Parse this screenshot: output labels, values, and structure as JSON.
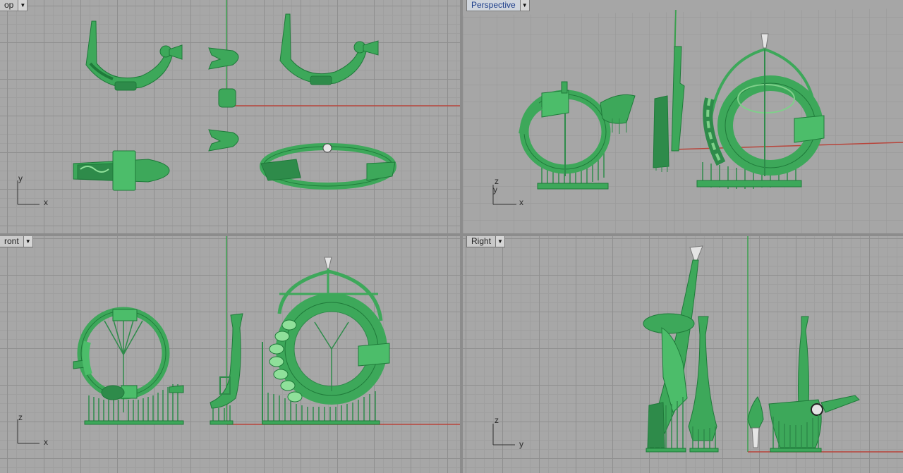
{
  "viewports": {
    "top": {
      "label": "op",
      "axis1": "y",
      "axis2": "x"
    },
    "persp": {
      "label": "Perspective",
      "axis1": "z",
      "axis1b": "y",
      "axis2": "x"
    },
    "front": {
      "label": "ront",
      "axis1": "z",
      "axis2": "x"
    },
    "right": {
      "label": "Right",
      "axis1": "z",
      "axis2": "y"
    }
  },
  "icons": {
    "dropdown": "chevron-down-icon"
  },
  "colors": {
    "model": "#3da85a",
    "model_dark": "#1f7a3a",
    "model_light": "#7fd08a",
    "x_axis": "#b8443a",
    "z_axis": "#3aa04e",
    "cone": "#e4e4e4"
  }
}
